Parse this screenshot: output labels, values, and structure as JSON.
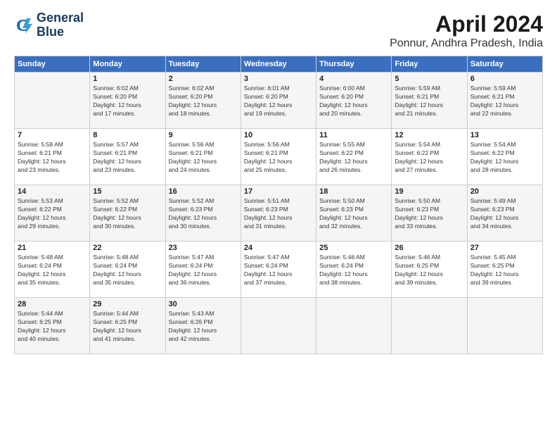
{
  "header": {
    "logo_line1": "General",
    "logo_line2": "Blue",
    "month_title": "April 2024",
    "location": "Ponnur, Andhra Pradesh, India"
  },
  "weekdays": [
    "Sunday",
    "Monday",
    "Tuesday",
    "Wednesday",
    "Thursday",
    "Friday",
    "Saturday"
  ],
  "weeks": [
    [
      {
        "day": "",
        "info": ""
      },
      {
        "day": "1",
        "info": "Sunrise: 6:02 AM\nSunset: 6:20 PM\nDaylight: 12 hours\nand 17 minutes."
      },
      {
        "day": "2",
        "info": "Sunrise: 6:02 AM\nSunset: 6:20 PM\nDaylight: 12 hours\nand 18 minutes."
      },
      {
        "day": "3",
        "info": "Sunrise: 6:01 AM\nSunset: 6:20 PM\nDaylight: 12 hours\nand 19 minutes."
      },
      {
        "day": "4",
        "info": "Sunrise: 6:00 AM\nSunset: 6:20 PM\nDaylight: 12 hours\nand 20 minutes."
      },
      {
        "day": "5",
        "info": "Sunrise: 5:59 AM\nSunset: 6:21 PM\nDaylight: 12 hours\nand 21 minutes."
      },
      {
        "day": "6",
        "info": "Sunrise: 5:59 AM\nSunset: 6:21 PM\nDaylight: 12 hours\nand 22 minutes."
      }
    ],
    [
      {
        "day": "7",
        "info": "Sunrise: 5:58 AM\nSunset: 6:21 PM\nDaylight: 12 hours\nand 23 minutes."
      },
      {
        "day": "8",
        "info": "Sunrise: 5:57 AM\nSunset: 6:21 PM\nDaylight: 12 hours\nand 23 minutes."
      },
      {
        "day": "9",
        "info": "Sunrise: 5:56 AM\nSunset: 6:21 PM\nDaylight: 12 hours\nand 24 minutes."
      },
      {
        "day": "10",
        "info": "Sunrise: 5:56 AM\nSunset: 6:21 PM\nDaylight: 12 hours\nand 25 minutes."
      },
      {
        "day": "11",
        "info": "Sunrise: 5:55 AM\nSunset: 6:22 PM\nDaylight: 12 hours\nand 26 minutes."
      },
      {
        "day": "12",
        "info": "Sunrise: 5:54 AM\nSunset: 6:22 PM\nDaylight: 12 hours\nand 27 minutes."
      },
      {
        "day": "13",
        "info": "Sunrise: 5:54 AM\nSunset: 6:22 PM\nDaylight: 12 hours\nand 28 minutes."
      }
    ],
    [
      {
        "day": "14",
        "info": "Sunrise: 5:53 AM\nSunset: 6:22 PM\nDaylight: 12 hours\nand 29 minutes."
      },
      {
        "day": "15",
        "info": "Sunrise: 5:52 AM\nSunset: 6:22 PM\nDaylight: 12 hours\nand 30 minutes."
      },
      {
        "day": "16",
        "info": "Sunrise: 5:52 AM\nSunset: 6:23 PM\nDaylight: 12 hours\nand 30 minutes."
      },
      {
        "day": "17",
        "info": "Sunrise: 5:51 AM\nSunset: 6:23 PM\nDaylight: 12 hours\nand 31 minutes."
      },
      {
        "day": "18",
        "info": "Sunrise: 5:50 AM\nSunset: 6:23 PM\nDaylight: 12 hours\nand 32 minutes."
      },
      {
        "day": "19",
        "info": "Sunrise: 5:50 AM\nSunset: 6:23 PM\nDaylight: 12 hours\nand 33 minutes."
      },
      {
        "day": "20",
        "info": "Sunrise: 5:49 AM\nSunset: 6:23 PM\nDaylight: 12 hours\nand 34 minutes."
      }
    ],
    [
      {
        "day": "21",
        "info": "Sunrise: 5:48 AM\nSunset: 6:24 PM\nDaylight: 12 hours\nand 35 minutes."
      },
      {
        "day": "22",
        "info": "Sunrise: 5:48 AM\nSunset: 6:24 PM\nDaylight: 12 hours\nand 35 minutes."
      },
      {
        "day": "23",
        "info": "Sunrise: 5:47 AM\nSunset: 6:24 PM\nDaylight: 12 hours\nand 36 minutes."
      },
      {
        "day": "24",
        "info": "Sunrise: 5:47 AM\nSunset: 6:24 PM\nDaylight: 12 hours\nand 37 minutes."
      },
      {
        "day": "25",
        "info": "Sunrise: 5:46 AM\nSunset: 6:24 PM\nDaylight: 12 hours\nand 38 minutes."
      },
      {
        "day": "26",
        "info": "Sunrise: 5:46 AM\nSunset: 6:25 PM\nDaylight: 12 hours\nand 39 minutes."
      },
      {
        "day": "27",
        "info": "Sunrise: 5:45 AM\nSunset: 6:25 PM\nDaylight: 12 hours\nand 39 minutes."
      }
    ],
    [
      {
        "day": "28",
        "info": "Sunrise: 5:44 AM\nSunset: 6:25 PM\nDaylight: 12 hours\nand 40 minutes."
      },
      {
        "day": "29",
        "info": "Sunrise: 5:44 AM\nSunset: 6:25 PM\nDaylight: 12 hours\nand 41 minutes."
      },
      {
        "day": "30",
        "info": "Sunrise: 5:43 AM\nSunset: 6:26 PM\nDaylight: 12 hours\nand 42 minutes."
      },
      {
        "day": "",
        "info": ""
      },
      {
        "day": "",
        "info": ""
      },
      {
        "day": "",
        "info": ""
      },
      {
        "day": "",
        "info": ""
      }
    ]
  ]
}
